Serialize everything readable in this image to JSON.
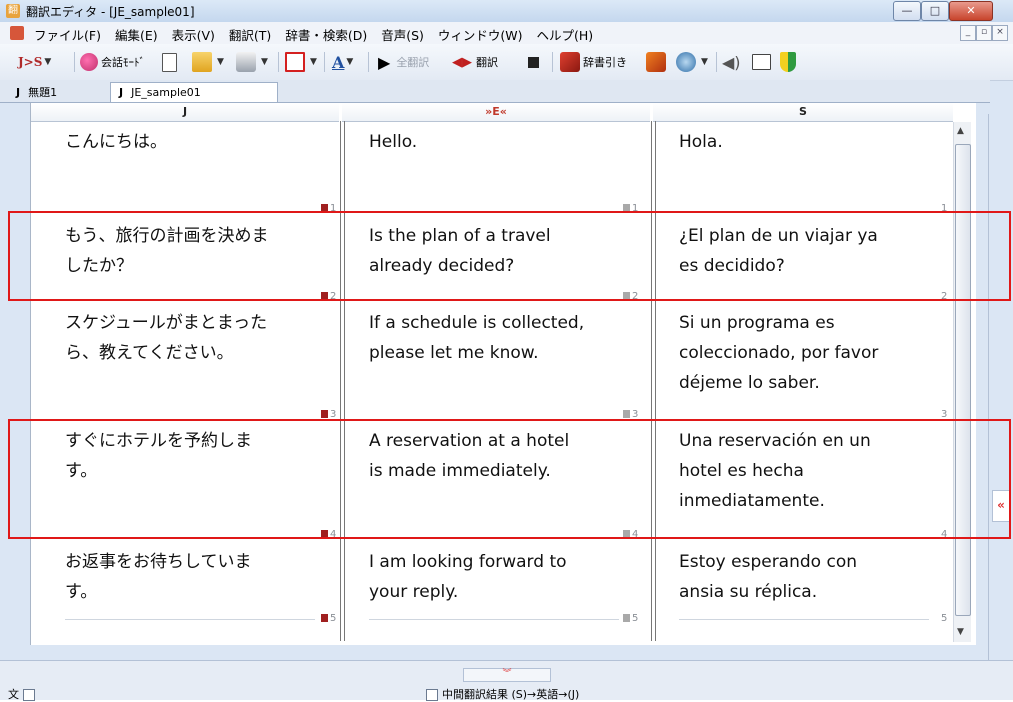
{
  "window": {
    "title": "翻訳エディタ - [JE_sample01]",
    "app_icon": "翻",
    "controls": {
      "minimize": "—",
      "maximize": "□",
      "close": "✕"
    }
  },
  "menu": {
    "items": [
      "ファイル(F)",
      "編集(E)",
      "表示(V)",
      "翻訳(T)",
      "辞書・検索(D)",
      "音声(S)",
      "ウィンドウ(W)",
      "ヘルプ(H)"
    ],
    "mdi_controls": [
      "_",
      "▫",
      "×"
    ]
  },
  "toolbar": {
    "lang_pair": "J>S",
    "conversation_mode": "会話ﾓｰﾄﾞ",
    "translate_all": "全翻訳",
    "translate": "翻訳",
    "dictionary_lookup": "辞書引き"
  },
  "tabs": [
    {
      "prefix": "J",
      "label": "無題1"
    },
    {
      "prefix": "J",
      "label": "JE_sample01"
    }
  ],
  "columns": {
    "j": "J",
    "e": "»E«",
    "s": "S"
  },
  "rows": [
    {
      "num": "1",
      "ja": "こんにちは。",
      "en": "Hello.",
      "es": "Hola."
    },
    {
      "num": "2",
      "ja": "もう、旅行の計画を決めま\nしたか？",
      "en": "Is the plan of a travel\nalready decided?",
      "es": "¿El plan de un viajar ya\nes decidido?"
    },
    {
      "num": "3",
      "ja": "スケジュールがまとまった\nら、教えてください。",
      "en": "If a schedule is collected,\nplease let me know.",
      "es": "Si un programa es\ncoleccionado, por favor\ndéjeme lo saber."
    },
    {
      "num": "4",
      "ja": "すぐにホテルを予約しま\nす。",
      "en": "A reservation at a hotel\nis made immediately.",
      "es": "Una reservación en un\nhotel es hecha\ninmediatamente."
    },
    {
      "num": "5",
      "ja": "お返事をお待ちしていま\nす。",
      "en": "I am looking forward to\nyour reply.",
      "es": "Estoy esperando con\nansia su réplica."
    }
  ],
  "bottom_pane": {
    "left_label": "文",
    "right_label": "中間翻訳結果 (S)→英語→(J)"
  },
  "highlight_color": "#e01818"
}
